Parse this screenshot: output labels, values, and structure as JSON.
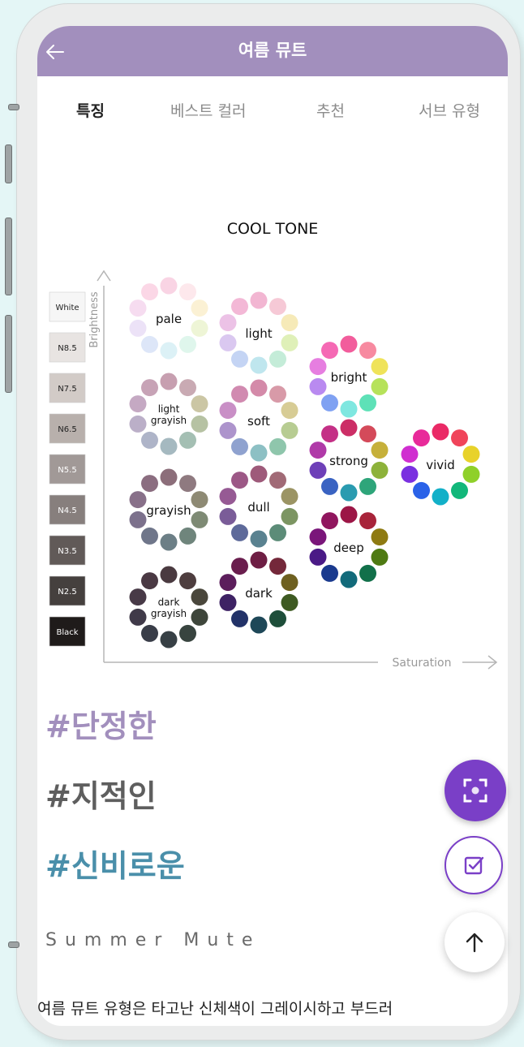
{
  "header": {
    "title": "여름 뮤트"
  },
  "tabs": [
    "특징",
    "베스트 컬러",
    "추천",
    "서브 유형"
  ],
  "chart": {
    "title": "COOL TONE",
    "y_axis_label": "Brightness",
    "x_axis_label": "Saturation",
    "scale": [
      {
        "label": "White",
        "color": "#f6f6f6",
        "text": "#222222"
      },
      {
        "label": "N8.5",
        "color": "#e8e4e2",
        "text": "#222222"
      },
      {
        "label": "N7.5",
        "color": "#d2cbc7",
        "text": "#222222"
      },
      {
        "label": "N6.5",
        "color": "#b8b0ac",
        "text": "#222222"
      },
      {
        "label": "N5.5",
        "color": "#a19997",
        "text": "#ffffff"
      },
      {
        "label": "N4.5",
        "color": "#877f7d",
        "text": "#ffffff"
      },
      {
        "label": "N3.5",
        "color": "#615a58",
        "text": "#ffffff"
      },
      {
        "label": "N2.5",
        "color": "#45403e",
        "text": "#ffffff"
      },
      {
        "label": "Black",
        "color": "#1f1b1a",
        "text": "#ffffff"
      }
    ],
    "tones": [
      {
        "label": [
          "pale"
        ],
        "colors": [
          "#f9d4e4",
          "#fde8ec",
          "#fbf1d4",
          "#eef5d6",
          "#dff6ec",
          "#dcf1f6",
          "#dde6f8",
          "#ece2f7",
          "#f6dcf0",
          "#fbd7e6"
        ]
      },
      {
        "label": [
          "light"
        ],
        "colors": [
          "#f2b6d2",
          "#f6c9d6",
          "#f6eab8",
          "#dff0b8",
          "#c4ecd8",
          "#bfe6ee",
          "#c4d4f4",
          "#dac8f0",
          "#ecc2e6",
          "#f3b8d6"
        ]
      },
      {
        "label": [
          "bright"
        ],
        "colors": [
          "#f25d9c",
          "#f78aa0",
          "#efe35a",
          "#b6e25a",
          "#5ee1b7",
          "#7fe7e0",
          "#7fa1f2",
          "#b98af0",
          "#e67ee0",
          "#f569b4"
        ]
      },
      {
        "label": [
          "light",
          "grayish"
        ],
        "colors": [
          "#c79fb0",
          "#c9aab3",
          "#cbc6a4",
          "#b6c2a3",
          "#a4bfb3",
          "#a5b9c0",
          "#aeb4c8",
          "#bbafc8",
          "#c5a9c3",
          "#c7a3b6"
        ]
      },
      {
        "label": [
          "soft"
        ],
        "colors": [
          "#d48aa9",
          "#d89aa8",
          "#d7cc95",
          "#b7cc92",
          "#8fc6ac",
          "#8dc0c4",
          "#8fa2cf",
          "#ad94cc",
          "#c98fc6",
          "#d18ab0"
        ]
      },
      {
        "label": [
          "strong"
        ],
        "colors": [
          "#cc2e66",
          "#d44a5a",
          "#c6b03a",
          "#8db23a",
          "#2ea57a",
          "#2a9bb0",
          "#3a63c2",
          "#6e40b8",
          "#b03aa8",
          "#c43086"
        ]
      },
      {
        "label": [
          "vivid"
        ],
        "colors": [
          "#ea2a66",
          "#f0445a",
          "#e8d22a",
          "#8fd02a",
          "#12b77a",
          "#12b0c8",
          "#2a62e8",
          "#7a30e0",
          "#d02ed0",
          "#e82a9a"
        ]
      },
      {
        "label": [
          "grayish"
        ],
        "colors": [
          "#8c6e7a",
          "#8f7a80",
          "#8e8a74",
          "#7e8a74",
          "#6f857c",
          "#6c7f86",
          "#6f768a",
          "#7c718c",
          "#887089",
          "#8b6d80"
        ]
      },
      {
        "label": [
          "dull"
        ],
        "colors": [
          "#9e5a7a",
          "#a16a76",
          "#9b9464",
          "#7c9562",
          "#5c8c78",
          "#5a8290",
          "#5e6a9a",
          "#7a5c98",
          "#965a94",
          "#9c5886"
        ]
      },
      {
        "label": [
          "deep"
        ],
        "colors": [
          "#9c1646",
          "#a8243a",
          "#8e7a12",
          "#4e7a12",
          "#12704a",
          "#126a7a",
          "#1a3a8e",
          "#4a1a86",
          "#7a167a",
          "#90165e"
        ]
      },
      {
        "label": [
          "dark",
          "grayish"
        ],
        "colors": [
          "#4a3a40",
          "#4e3e3f",
          "#4a473c",
          "#3e463b",
          "#38443f",
          "#374045",
          "#393d48",
          "#403a49",
          "#483a47",
          "#4a3943"
        ]
      },
      {
        "label": [
          "dark"
        ],
        "colors": [
          "#6e1e44",
          "#74283a",
          "#6e6020",
          "#3e5a22",
          "#1e4e3a",
          "#1e4858",
          "#223268",
          "#3e2264",
          "#5c1e5c",
          "#6a1e4e"
        ]
      }
    ]
  },
  "tags": [
    "#단정한",
    "#지적인",
    "#신비로운"
  ],
  "subtitle": "Summer Mute",
  "description": "여름 뮤트 유형은 타고난 신체색이 그레이시하고 부드러"
}
